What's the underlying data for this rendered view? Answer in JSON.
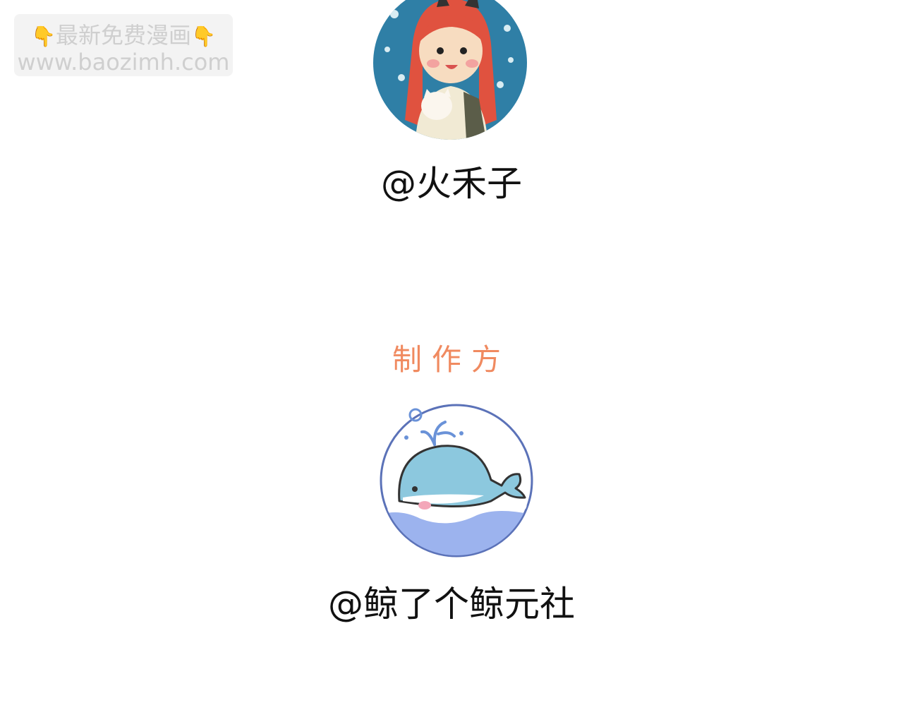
{
  "watermark": {
    "line1": "最新免费漫画",
    "hand_icon": "👇",
    "line2": "www.baozimh.com"
  },
  "author": {
    "name": "@火禾子",
    "avatar_icon": "girl-portrait-avatar"
  },
  "producer": {
    "section_title": "制作方",
    "name": "@鲸了个鲸元社",
    "avatar_icon": "whale-logo-avatar"
  },
  "colors": {
    "section_title": "#f08a60",
    "text": "#111111",
    "watermark_text": "#cfcfcf",
    "avatar1_bg": "#2f7fa6",
    "whale_body": "#8cc8de",
    "water": "#9cb3ee"
  }
}
